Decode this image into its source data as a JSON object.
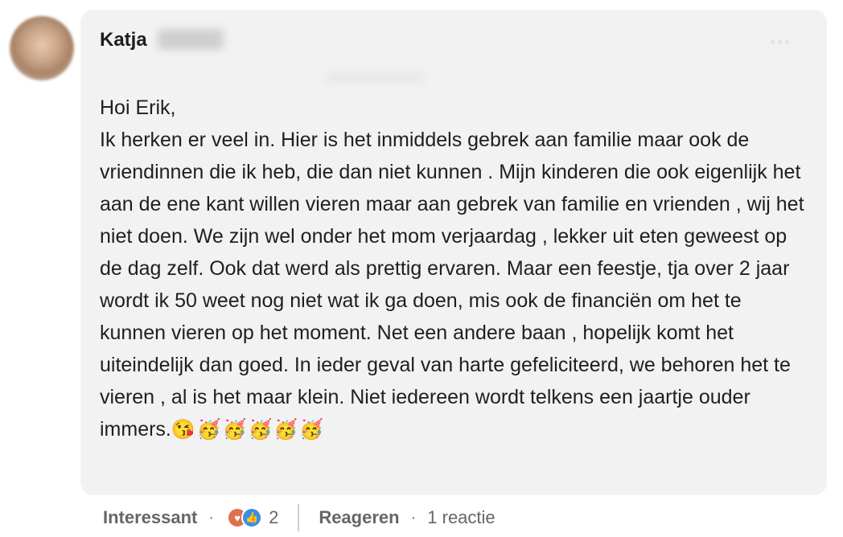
{
  "author": {
    "name": "Katja"
  },
  "comment": {
    "greeting": "Hoi Erik,",
    "body": "Ik herken er veel in. Hier is het inmiddels gebrek aan familie maar ook de vriendinnen die ik heb, die dan niet kunnen . Mijn kinderen die ook eigenlijk het aan de ene kant willen vieren maar aan gebrek van familie en vrienden , wij het niet doen. We zijn wel onder het mom verjaardag , lekker uit eten geweest op de dag zelf. Ook dat werd als prettig ervaren. Maar een feestje, tja over 2 jaar wordt ik 50 weet nog niet wat ik ga doen, mis ook de financiën om het te kunnen vieren op het moment. Net een andere baan , hopelijk komt het uiteindelijk dan goed. In ieder geval van harte gefeliciteerd, we behoren het te vieren , al is het maar klein. Niet iedereen wordt telkens een jaartje ouder immers.",
    "emojis": "😘🥳🥳🥳🥳🥳"
  },
  "footer": {
    "interesting_label": "Interessant",
    "reaction_icons": [
      "love-reaction-icon",
      "like-reaction-icon"
    ],
    "reaction_count": "2",
    "reply_label": "Reageren",
    "replies_text": "1 reactie"
  },
  "colors": {
    "bubble_bg": "#f2f2f2",
    "love": "#df704d",
    "like": "#378fe9"
  }
}
